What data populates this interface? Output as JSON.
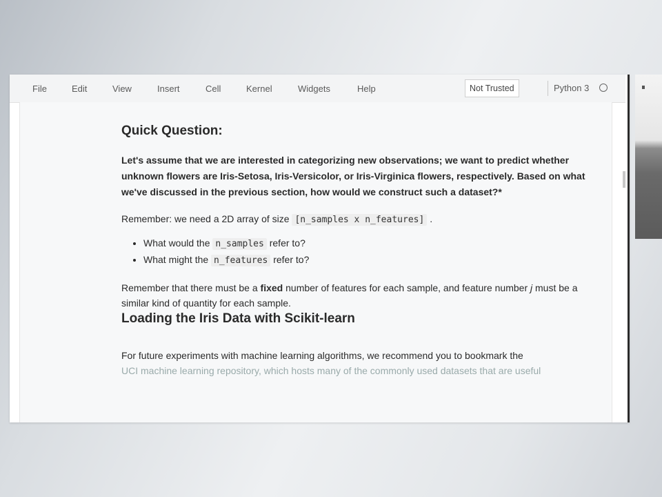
{
  "menubar": {
    "items": [
      "File",
      "Edit",
      "View",
      "Insert",
      "Cell",
      "Kernel",
      "Widgets",
      "Help"
    ],
    "trust_label": "Not Trusted",
    "kernel_name": "Python 3",
    "kernel_status_icon": "circle-icon"
  },
  "notebook": {
    "quick_question_title": "Quick Question:",
    "question_text": "Let's assume that we are interested in categorizing new observations; we want to predict whether unknown flowers are Iris-Setosa, Iris-Versicolor, or Iris-Virginica flowers, respectively. Based on what we've discussed in the previous section, how would we construct such a dataset?*",
    "remember_prefix": "Remember: we need a 2D array of size ",
    "remember_code": "[n_samples x n_features]",
    "remember_suffix": ".",
    "bullets": [
      {
        "prefix": "What would the ",
        "code": "n_samples",
        "suffix": " refer to?"
      },
      {
        "prefix": "What might the ",
        "code": "n_features",
        "suffix": " refer to?"
      }
    ],
    "fixed_prefix": "Remember that there must be a ",
    "fixed_bold": "fixed",
    "fixed_middle": " number of features for each sample, and feature number ",
    "fixed_italic": "j",
    "fixed_suffix": " must be a similar kind of quantity for each sample.",
    "loading_title": "Loading the Iris Data with Scikit-learn",
    "future_text": "For future experiments with machine learning algorithms, we recommend you to bookmark the",
    "future_text_cut": "UCI machine learning repository, which hosts many of the commonly used datasets that are useful"
  }
}
